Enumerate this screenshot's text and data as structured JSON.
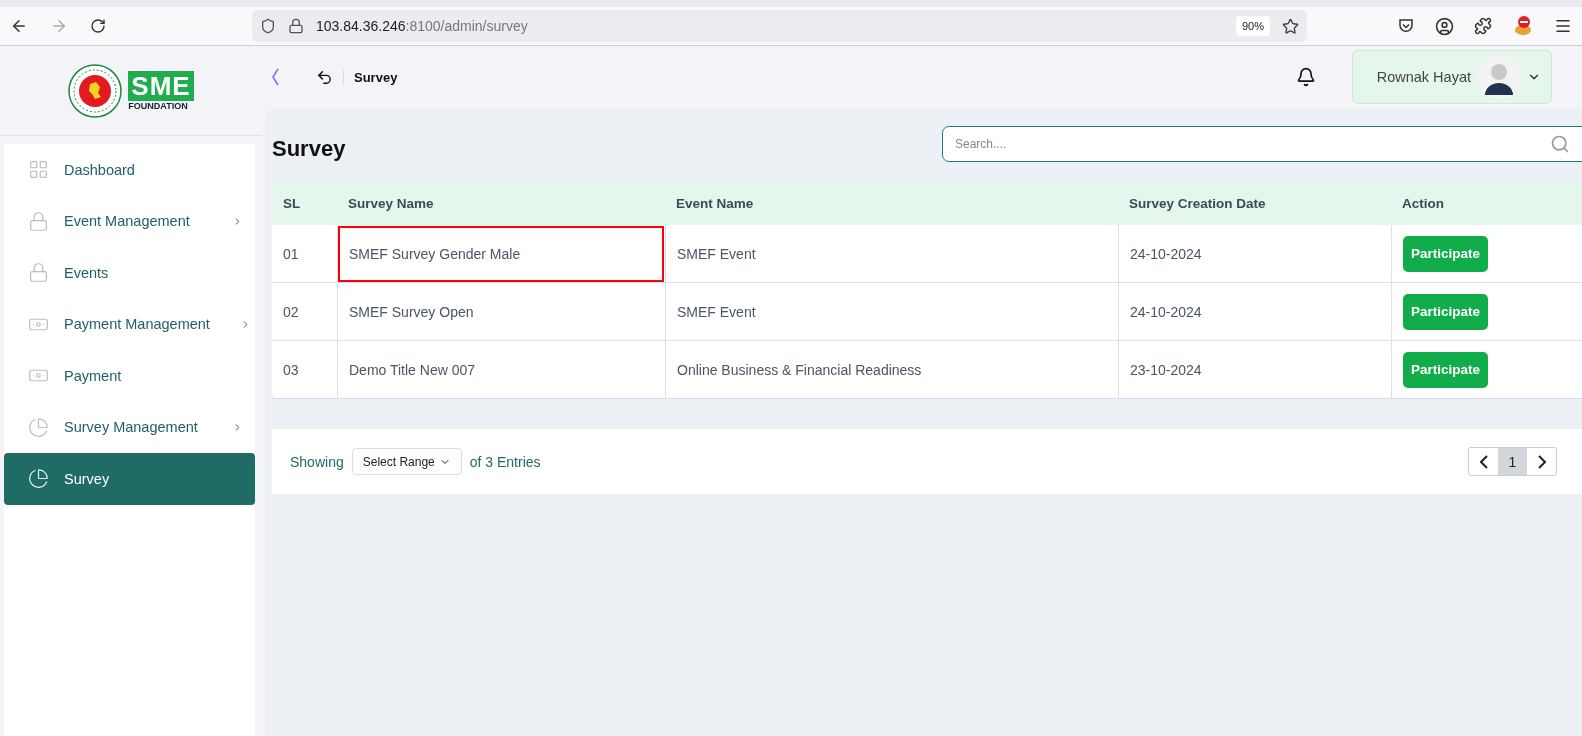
{
  "browser": {
    "address": {
      "host": "103.84.36.246",
      "path": ":8100/admin/survey"
    },
    "zoom": "90%"
  },
  "logo": {
    "mark": "SME",
    "caption": "FOUNDATION"
  },
  "sidebar": {
    "items": [
      {
        "label": "Dashboard",
        "expandable": false,
        "selected": false
      },
      {
        "label": "Event Management",
        "expandable": true,
        "selected": false
      },
      {
        "label": "Events",
        "expandable": false,
        "selected": false
      },
      {
        "label": "Payment Management",
        "expandable": true,
        "selected": false
      },
      {
        "label": "Payment",
        "expandable": false,
        "selected": false
      },
      {
        "label": "Survey Management",
        "expandable": true,
        "selected": false
      },
      {
        "label": "Survey",
        "expandable": false,
        "selected": true
      }
    ]
  },
  "header": {
    "breadcrumb": "Survey",
    "user": "Rownak Hayat"
  },
  "page": {
    "title": "Survey",
    "search": {
      "placeholder": "Search...."
    }
  },
  "table": {
    "columns": [
      "SL",
      "Survey Name",
      "Event Name",
      "Survey Creation Date",
      "Action"
    ],
    "rows": [
      {
        "sl": "01",
        "survey_name": "SMEF Survey Gender Male",
        "event_name": "SMEF Event",
        "date": "24-10-2024",
        "action": "Participate",
        "highlighted": true
      },
      {
        "sl": "02",
        "survey_name": "SMEF Survey Open",
        "event_name": "SMEF Event",
        "date": "24-10-2024",
        "action": "Participate",
        "highlighted": false
      },
      {
        "sl": "03",
        "survey_name": "Demo Title New 007",
        "event_name": "Online Business & Financial Readiness",
        "date": "23-10-2024",
        "action": "Participate",
        "highlighted": false
      }
    ]
  },
  "footer": {
    "showing": "Showing",
    "range": "Select Range",
    "entries": "of 3 Entries",
    "pages": [
      {
        "label": "1",
        "selected": true
      }
    ]
  }
}
